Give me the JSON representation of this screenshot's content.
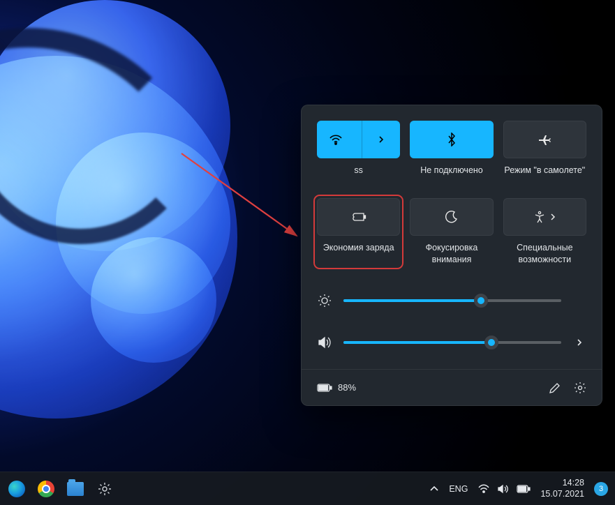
{
  "quick_settings": {
    "tiles": [
      {
        "id": "wifi",
        "label": "ss",
        "active": true,
        "expandable": true
      },
      {
        "id": "bluetooth",
        "label": "Не подключено",
        "active": true,
        "expandable": false
      },
      {
        "id": "airplane",
        "label": "Режим \"в самолете\"",
        "active": false,
        "expandable": false
      },
      {
        "id": "battery-saver",
        "label": "Экономия заряда",
        "active": false,
        "expandable": false,
        "highlighted": true
      },
      {
        "id": "focus",
        "label": "Фокусировка внимания",
        "active": false,
        "expandable": false
      },
      {
        "id": "accessibility",
        "label": "Специальные возможности",
        "active": false,
        "expandable": true
      }
    ],
    "brightness_percent": 63,
    "volume_percent": 68,
    "battery_text": "88%"
  },
  "taskbar": {
    "language": "ENG",
    "time": "14:28",
    "date": "15.07.2021",
    "notification_count": "3"
  }
}
